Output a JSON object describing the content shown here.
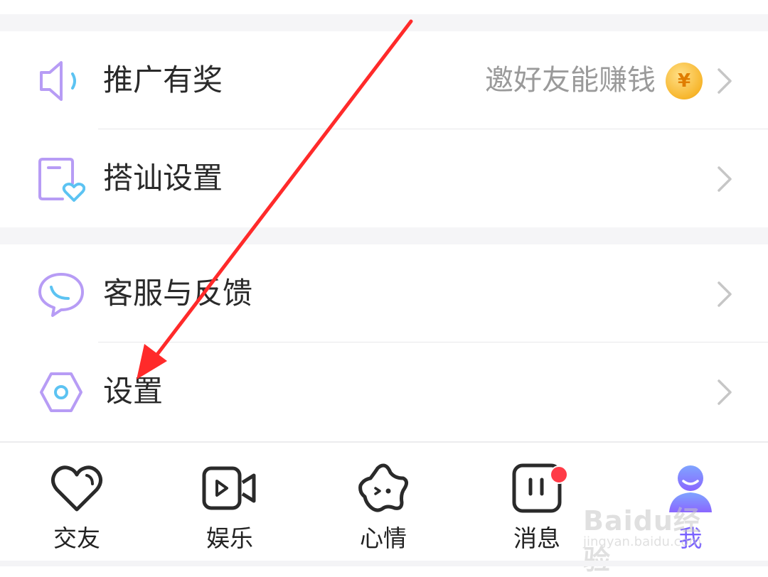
{
  "menu": {
    "promote": {
      "label": "推广有奖",
      "hint": "邀好友能赚钱",
      "coin_symbol": "¥",
      "icon": "speaker-icon"
    },
    "chat_settings": {
      "label": "搭讪设置",
      "icon": "card-heart-icon"
    },
    "support": {
      "label": "客服与反馈",
      "icon": "chat-bubble-icon"
    },
    "settings": {
      "label": "设置",
      "icon": "hexagon-gear-icon"
    }
  },
  "tabbar": {
    "tabs": [
      {
        "label": "交友",
        "icon": "heart-icon"
      },
      {
        "label": "娱乐",
        "icon": "video-icon"
      },
      {
        "label": "心情",
        "icon": "star-face-icon"
      },
      {
        "label": "消息",
        "icon": "message-icon",
        "badge": true
      },
      {
        "label": "我",
        "icon": "user-icon",
        "active": true
      }
    ]
  },
  "watermark": {
    "brand": "Baidu经验",
    "url": "jingyan.baidu.com"
  },
  "colors": {
    "accent": "#7a62ff",
    "icon_purple": "#b79cf5",
    "icon_blue": "#5cc3f2",
    "badge": "#ff3b47",
    "arrow": "#ff2a2a"
  }
}
